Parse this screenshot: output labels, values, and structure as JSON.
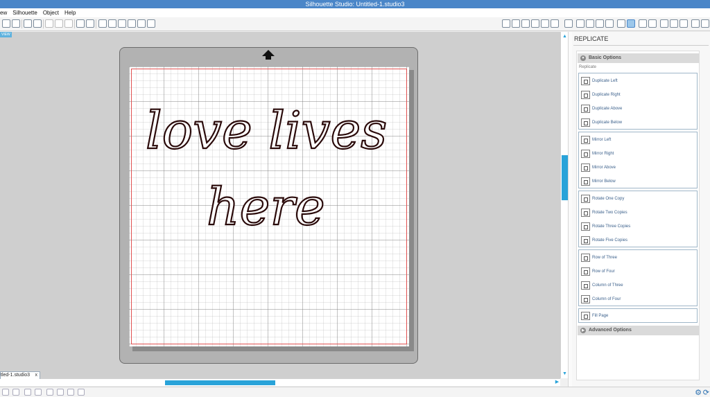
{
  "window": {
    "title": "Silhouette Studio: Untitled-1.studio3"
  },
  "menu": [
    "ew",
    "Silhouette",
    "Object",
    "Help"
  ],
  "canvas": {
    "view_tag": "VIEW",
    "text_line1": "love  lives",
    "text_line2": "here"
  },
  "document_tab": {
    "label": "tled-1.studio3",
    "close": "x"
  },
  "panel": {
    "title": "REPLICATE",
    "basic_options": "Basic Options",
    "replicate_label": "Replicate",
    "advanced_options": "Advanced Options",
    "groups": [
      [
        "Duplicate Left",
        "Duplicate Right",
        "Duplicate Above",
        "Duplicate Below"
      ],
      [
        "Mirror Left",
        "Mirror Right",
        "Mirror Above",
        "Mirror Below"
      ],
      [
        "Rotate One Copy",
        "Rotate Two Copies",
        "Rotate Three Copies",
        "Rotate Five Copies"
      ],
      [
        "Row of Three",
        "Row of Four",
        "Column of Three",
        "Column of Four"
      ],
      [
        "Fill Page"
      ]
    ]
  },
  "icons": {
    "up_arrow": "up-arrow-icon",
    "gear": "gear-icon",
    "sync": "sync-icon"
  },
  "colors": {
    "accent": "#29a3d9",
    "titlebar": "#4a86c8",
    "cut_line": "#e05050",
    "script_text": "#2a0a0a"
  }
}
